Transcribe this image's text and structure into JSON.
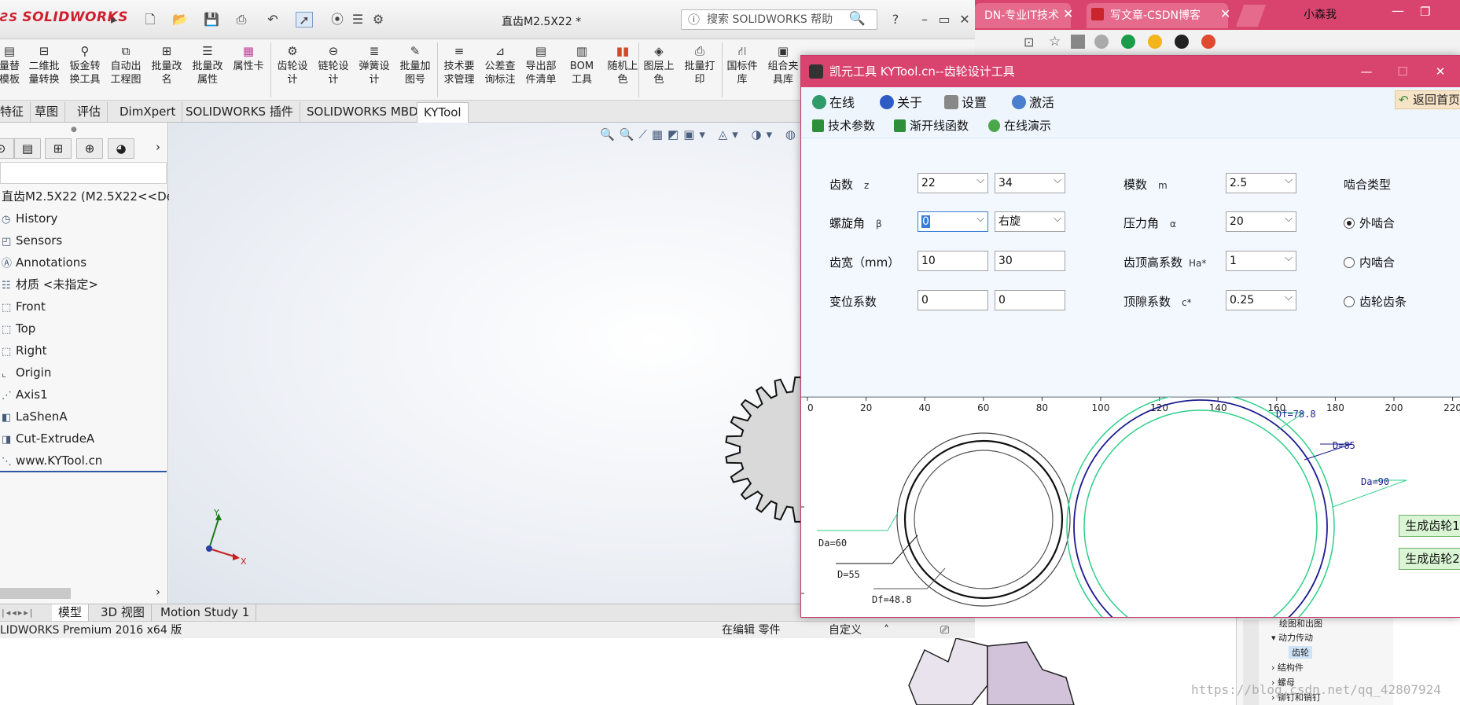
{
  "browser": {
    "tab1": "DN-专业IT技术",
    "tab2": "写文章-CSDN博客",
    "user": "小森我"
  },
  "sw": {
    "logo": "SOLIDWORKS",
    "title": "直齿M2.5X22 *",
    "search_placeholder": "搜索 SOLIDWORKS 帮助",
    "help": "?",
    "ribbon": [
      [
        "量替",
        "模板"
      ],
      [
        "二维批",
        "量转换"
      ],
      [
        "钣金转",
        "换工具"
      ],
      [
        "自动出",
        "工程图"
      ],
      [
        "批量改",
        "名"
      ],
      [
        "批量改",
        "属性"
      ],
      [
        "属性卡",
        ""
      ],
      [
        "齿轮设",
        "计"
      ],
      [
        "链轮设",
        "计"
      ],
      [
        "弹簧设",
        "计"
      ],
      [
        "批量加",
        "图号"
      ],
      [
        "技术要",
        "求管理"
      ],
      [
        "公差查",
        "询标注"
      ],
      [
        "导出部",
        "件清单"
      ],
      [
        "BOM",
        "工具"
      ],
      [
        "随机上",
        "色"
      ],
      [
        "图层上",
        "色"
      ],
      [
        "批量打",
        "印"
      ],
      [
        "国标件",
        "库"
      ],
      [
        "组合夹",
        "具库"
      ]
    ],
    "tabs": [
      "特征",
      "草图",
      "评估",
      "DimXpert",
      "SOLIDWORKS 插件",
      "SOLIDWORKS MBD",
      "KYTool"
    ],
    "tree_root": "直齿M2.5X22  (M2.5X22<<De",
    "tree": [
      "History",
      "Sensors",
      "Annotations",
      "材质 <未指定>",
      "Front",
      "Top",
      "Right",
      "Origin",
      "Axis1",
      "LaShenA",
      "Cut-ExtrudeA",
      "www.KYTool.cn"
    ],
    "bottom_tabs": [
      "模型",
      "3D 视图",
      "Motion Study 1"
    ],
    "status_left": "LIDWORKS Premium 2016 x64 版",
    "status_edit": "在编辑 零件",
    "status_custom": "自定义",
    "axis_y": "Y",
    "axis_x": "X"
  },
  "bg": {
    "tree": [
      "绘图和出图",
      "动力传动",
      "齿轮",
      "结构件",
      "螺母",
      "铆钉和销钉"
    ],
    "watermark": "https://blog.csdn.net/qq_42807924"
  },
  "ky": {
    "title": "凯元工具 KYTool.cn--齿轮设计工具",
    "menu": [
      "在线",
      "关于",
      "设置",
      "激活"
    ],
    "back": "返回首页",
    "sub": [
      "技术参数",
      "渐开线函数",
      "在线演示"
    ],
    "labels": {
      "teeth": "齿数",
      "teeth_sym": "z",
      "helix": "螺旋角",
      "helix_sym": "β",
      "width": "齿宽（mm）",
      "shift": "变位系数",
      "module": "模数",
      "module_sym": "m",
      "pressure": "压力角",
      "pressure_sym": "α",
      "addendum": "齿顶高系数",
      "addendum_sym": "Ha*",
      "clearance": "顶隙系数",
      "clearance_sym": "c*",
      "mesh_type": "啮合类型"
    },
    "values": {
      "z1": "22",
      "z2": "34",
      "beta": "0",
      "hand": "右旋",
      "b1": "10",
      "b2": "30",
      "x1": "0",
      "x2": "0",
      "m": "2.5",
      "alpha": "20",
      "ha": "1",
      "c": "0.25"
    },
    "mesh": [
      "外啮合",
      "内啮合",
      "齿轮齿条"
    ],
    "mesh_selected": 0,
    "ruler": [
      "0",
      "20",
      "40",
      "60",
      "80",
      "100",
      "120",
      "140",
      "160",
      "180",
      "200",
      "220"
    ],
    "gear1": {
      "da": "Da=60",
      "d": "D=55",
      "df": "Df=48.8"
    },
    "gear2": {
      "df": "Df=78.8",
      "d": "D=85",
      "da": "Da=90"
    },
    "gen1": "生成齿轮1",
    "gen2": "生成齿轮2"
  },
  "colors": {
    "accent": "#d9446e",
    "circle_outer": "#2ecf8a",
    "circle_pitch": "#1b1b8f"
  }
}
